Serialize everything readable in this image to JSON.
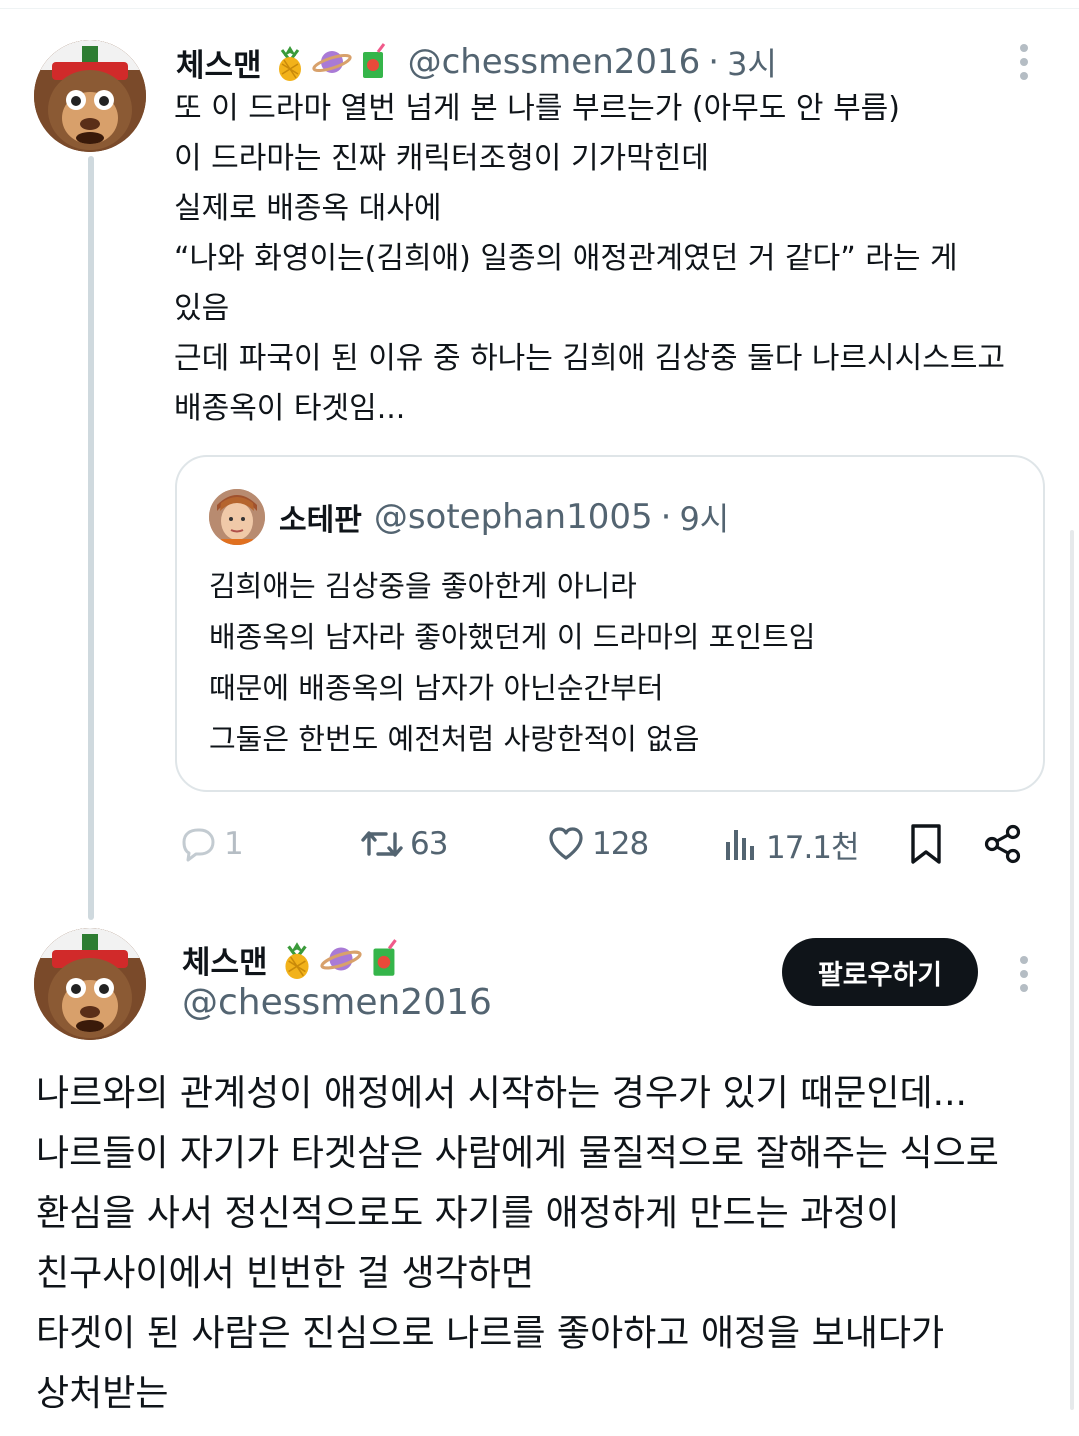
{
  "main_tweet": {
    "author_name": "체스맨",
    "author_emojis": [
      "pineapple-emoji",
      "planet-emoji",
      "juice-box-emoji"
    ],
    "handle": "@chessmen2016",
    "separator": "·",
    "time": "3시",
    "lines": [
      "또 이 드라마 열번 넘게 본 나를 부르는가 (아무도 안 부름)",
      "이 드라마는 진짜 캐릭터조형이 기가막힌데",
      "실제로 배종옥 대사에",
      "“나와 화영이는(김희애) 일종의 애정관계였던 거 같다” 라는 게",
      "있음",
      "근데 파국이 된 이유 중 하나는 김희애 김상중 둘다 나르시시스트고",
      "배종옥이 타겟임..."
    ],
    "quoted": {
      "author_name": "소테판",
      "handle": "@sotephan1005",
      "separator": "·",
      "time": "9시",
      "lines": [
        "김희애는 김상중을 좋아한게 아니라",
        "배종옥의 남자라 좋아했던게 이 드라마의 포인트임",
        "때문에 배종옥의 남자가 아닌순간부터",
        "그둘은 한번도 예전처럼 사랑한적이 없음"
      ]
    },
    "actions": {
      "replies": "1",
      "retweets": "63",
      "likes": "128",
      "views": "17.1천"
    }
  },
  "reply_tweet": {
    "author_name": "체스맨",
    "author_emojis": [
      "pineapple-emoji",
      "planet-emoji",
      "juice-box-emoji"
    ],
    "handle": "@chessmen2016",
    "follow_label": "팔로우하기",
    "lines": [
      "나르와의 관계성이 애정에서 시작하는 경우가 있기 때문인데...",
      "나르들이 자기가 타겟삼은 사람에게 물질적으로 잘해주는 식으로",
      "환심을 사서 정신적으로도 자기를 애정하게 만드는 과정이",
      "친구사이에서 빈번한 걸 생각하면",
      "타겟이 된 사람은 진심으로 나르를 좋아하고 애정을 보내다가",
      "상처받는"
    ]
  },
  "colors": {
    "text": "#0f1419",
    "secondary": "#536471",
    "border": "#dfe5e8",
    "thread_line": "#cfd9de",
    "follow_bg": "#0f1419"
  }
}
